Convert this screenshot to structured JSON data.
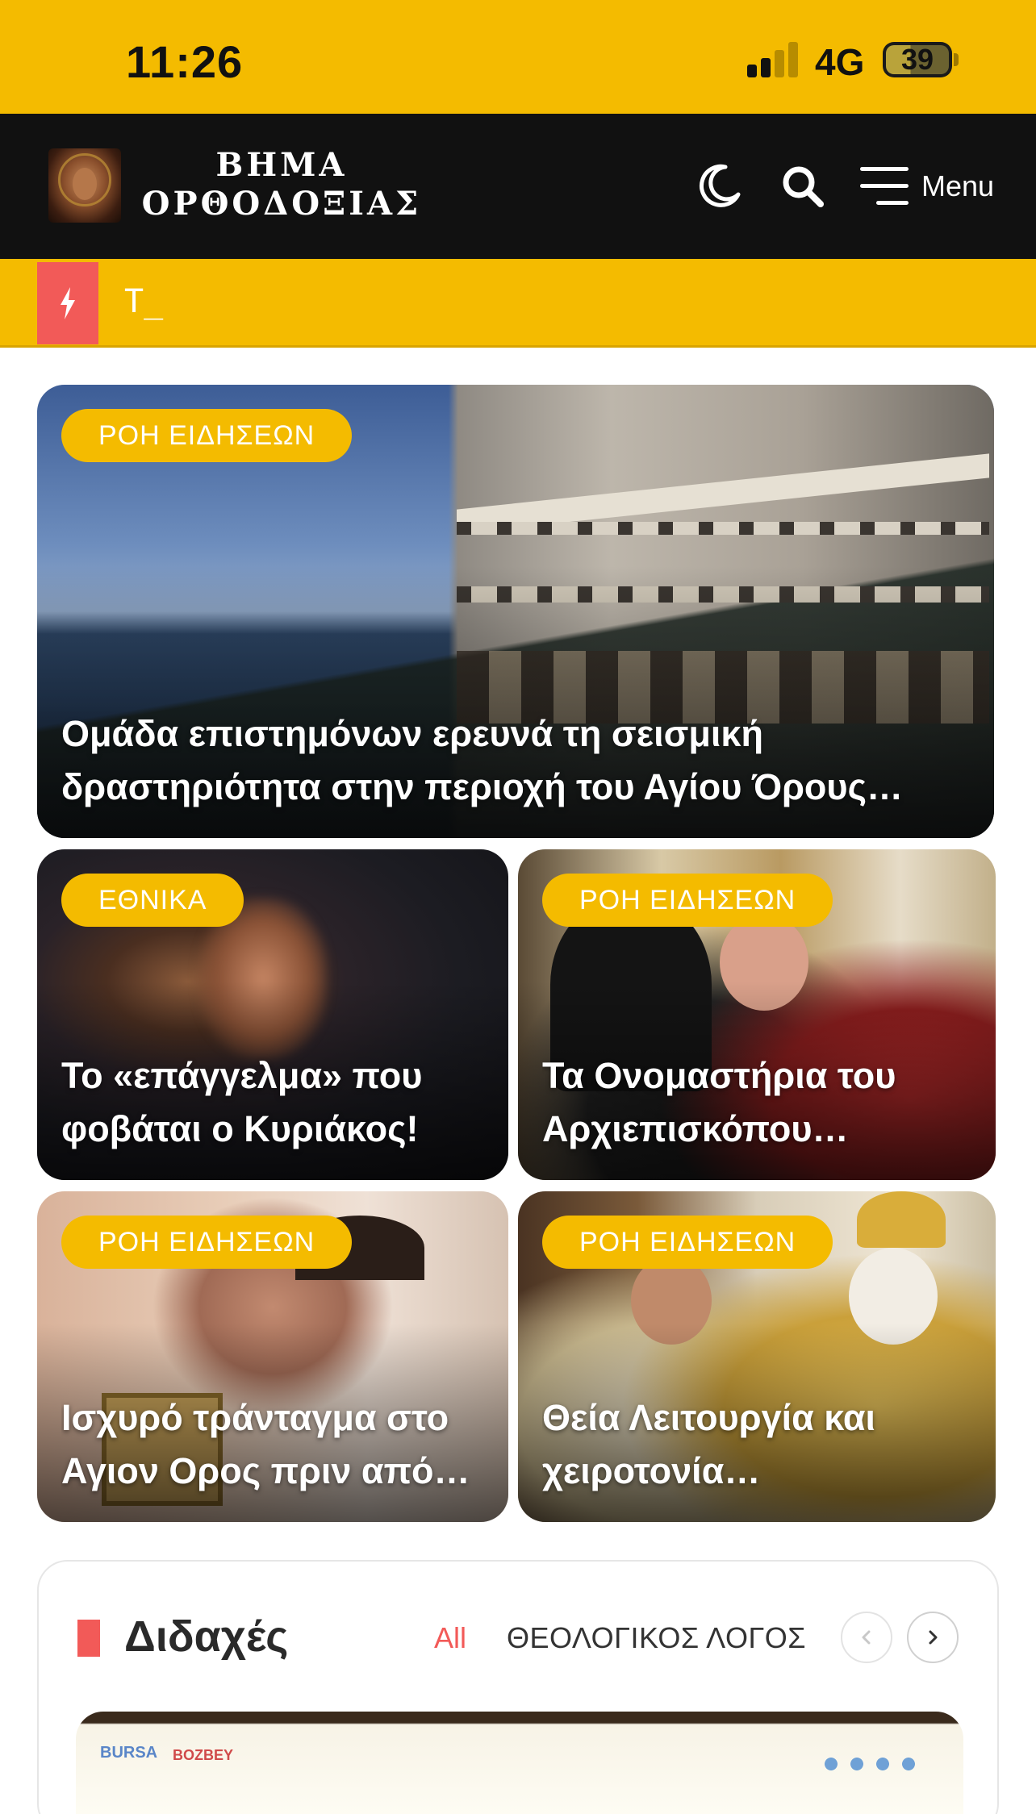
{
  "status_bar": {
    "time": "11:26",
    "network": "4G",
    "battery": "39",
    "battery_level": 0.39
  },
  "header": {
    "logo_line1": "ΒΗΜΑ",
    "logo_line2": "ΟΡΘΟΔΟΞΙΑΣ",
    "menu_label": "Menu",
    "icons": [
      "dark-mode-moon-icon",
      "search-icon",
      "hamburger-menu-icon"
    ]
  },
  "ticker": {
    "icon": "lightning-bolt-icon",
    "text": "T_"
  },
  "cards": [
    {
      "category": "ΡΟΗ ΕΙΔΗΣΕΩΝ",
      "title": "Ομάδα επιστημόνων ερευνά τη σεισμική δραστηριότητα στην περιοχή του Αγίου Όρους…"
    },
    {
      "category": "ΕΘΝΙΚΑ",
      "title": "Το «επάγγελμα» που φοβάται ο Κυριάκος!"
    },
    {
      "category": "ΡΟΗ ΕΙΔΗΣΕΩΝ",
      "title": "Τα Ονομαστήρια του Αρχιεπισκόπου…"
    },
    {
      "category": "ΡΟΗ ΕΙΔΗΣΕΩΝ",
      "title": "Ισχυρό τράνταγμα στο Αγιον Ορος πριν από…"
    },
    {
      "category": "ΡΟΗ ΕΙΔΗΣΕΩΝ",
      "title": "Θεία Λειτουργία και χειροτονία…"
    }
  ],
  "section": {
    "title": "Διδαχές",
    "tabs": [
      "All",
      "ΘΕΟΛΟΓΙΚΟΣ ΛΟΓΟΣ"
    ],
    "active_tab": "All",
    "preview_logo_1": "BURSA",
    "preview_logo_2": "BOZBEY"
  },
  "colors": {
    "accent_yellow": "#f4bb00",
    "header_black": "#111111",
    "accent_red": "#f25a58"
  }
}
